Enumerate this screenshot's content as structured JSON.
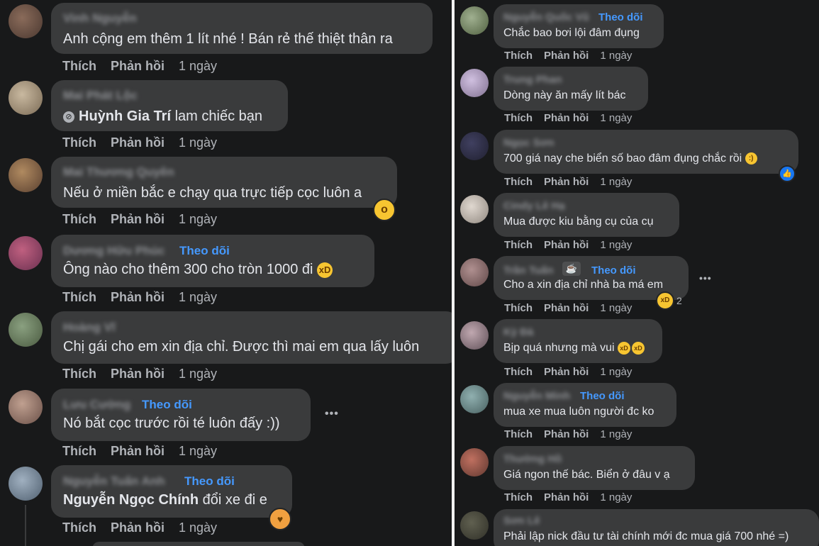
{
  "labels": {
    "like": "Thích",
    "reply": "Phản hồi",
    "follow": "Theo dõi",
    "more": "•••"
  },
  "left": [
    {
      "name": "Vinh Nguyễn",
      "text": "Anh cộng em thêm 1 lít nhé ! Bán rẻ thế thiệt thân ra",
      "time": "1 ngày"
    },
    {
      "name": "Mai Phát Lộc",
      "mention": "Huỳnh Gia Trí",
      "text": "lam chiếc bạn",
      "time": "1 ngày"
    },
    {
      "name": "Mai Thương Quyên",
      "text": "Nếu ở miền bắc e chạy qua trực tiếp cọc luôn a",
      "time": "1 ngày",
      "reaction": "wow"
    },
    {
      "name": "Dương Hữu Phúc",
      "follow": true,
      "text": "Ông nào cho thêm 300 cho tròn 1000 đi",
      "emoji": "laugh",
      "time": "1 ngày"
    },
    {
      "name": "Hoàng Vĩ",
      "text": "Chị gái cho em xin địa chỉ. Được thì mai em qua lấy luôn",
      "time": "1 ngày"
    },
    {
      "name": "Lưu Cường",
      "follow": true,
      "text": "Nó bắt cọc trước rồi té luôn đấy :))",
      "time": "1 ngày",
      "more": true
    },
    {
      "name": "Nguyễn Tuấn Anh",
      "follow": true,
      "mention": "Nguyễn Ngọc Chính",
      "text": "đổi xe đi e",
      "time": "1 ngày",
      "reaction": "care"
    }
  ],
  "right": [
    {
      "name": "Nguyễn Quốc Vũ",
      "follow": true,
      "text": "Chắc bao bơi lội đâm đụng",
      "time": "1 ngày"
    },
    {
      "name": "Trung Phan",
      "text": "Dòng này ăn mấy lít bác",
      "time": "1 ngày"
    },
    {
      "name": "Ngọc Sơn",
      "text": "700 giá nay che biển số bao đâm đụng chắc rồi",
      "emoji": "smile",
      "time": "1 ngày",
      "reaction": "like"
    },
    {
      "name": "Cindy Lê Hạ",
      "text": "Mua được kiu bằng cụ của cụ",
      "time": "1 ngày"
    },
    {
      "name": "Trần Tuấn",
      "follow": true,
      "badge": "☕",
      "text": "Cho a xin địa chỉ nhà ba má em",
      "time": "1 ngày",
      "reaction": "laugh",
      "reaction_count": "2",
      "more": true
    },
    {
      "name": "Kỳ Đà",
      "text": "Bịp quá nhưng mà vui",
      "emoji2": true,
      "time": "1 ngày"
    },
    {
      "name": "Nguyễn Minh",
      "follow": true,
      "text": "mua xe mua luôn người đc ko",
      "time": "1 ngày"
    },
    {
      "name": "Thường Hồ",
      "text": "Giá ngon thế bác. Biển ở đâu v ạ",
      "time": "1 ngày"
    },
    {
      "name": "Sơn Lê",
      "text": "Phải lập nick đầu tư tài chính mới đc mua giá 700 nhé =)"
    }
  ],
  "colors": {
    "background": "#18191a",
    "bubble": "#3a3b3c",
    "follow": "#4599ff",
    "meta": "#b0b3b8"
  },
  "icons": {
    "emoji_laugh": "😂",
    "emoji_smile": "🙂",
    "emoji_wow": "😮",
    "emoji_care": "🥰",
    "like": "👍"
  }
}
